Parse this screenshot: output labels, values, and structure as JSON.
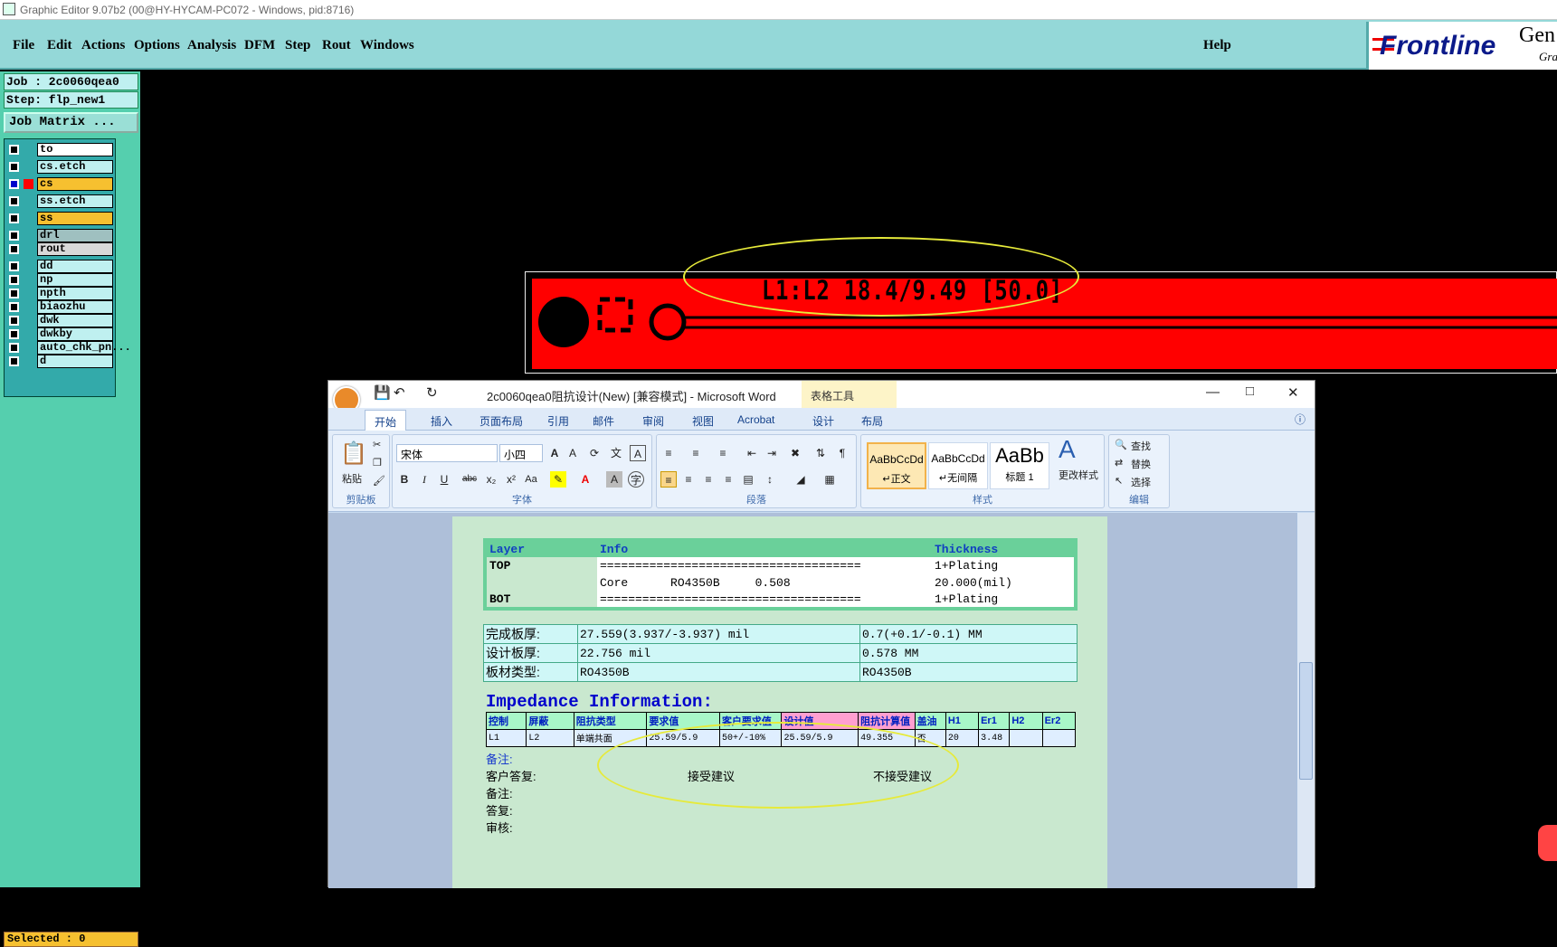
{
  "window": {
    "title": "Graphic Editor 9.07b2 (00@HY-HYCAM-PC072 - Windows, pid:8716)"
  },
  "menu": {
    "items": [
      "File",
      "Edit",
      "Actions",
      "Options",
      "Analysis",
      "DFM",
      "Step",
      "Rout",
      "Windows"
    ],
    "help": "Help"
  },
  "logo": {
    "brand": "Frontline",
    "product": "Gen",
    "sub": "Gra"
  },
  "left": {
    "job": "Job : 2c0060qea0",
    "step": "Step: flp_new1",
    "matrix_button": "Job Matrix ...",
    "selected": "Selected : 0"
  },
  "layers": [
    {
      "name": "to",
      "color": "#ffffff"
    },
    {
      "name": "cs.etch",
      "color": "#bff0f0"
    },
    {
      "name": "cs",
      "color": "#f6c030"
    },
    {
      "name": "ss.etch",
      "color": "#bff0f0"
    },
    {
      "name": "ss",
      "color": "#f6c030"
    },
    {
      "name": "drl",
      "color": "#9fc0c0"
    },
    {
      "name": "rout",
      "color": "#d8d8d8"
    },
    {
      "name": "dd",
      "color": "#bff0f0"
    },
    {
      "name": "np",
      "color": "#bff0f0"
    },
    {
      "name": "npth",
      "color": "#bff0f0"
    },
    {
      "name": "biaozhu",
      "color": "#bff0f0"
    },
    {
      "name": "dwk",
      "color": "#bff0f0"
    },
    {
      "name": "dwkby",
      "color": "#bff0f0"
    },
    {
      "name": "auto_chk_pn...",
      "color": "#bff0f0"
    },
    {
      "name": "d",
      "color": "#bff0f0"
    }
  ],
  "canvas": {
    "label": "L1:L2  18.4/9.49  [50.0]"
  },
  "word": {
    "title": "2c0060qea0阻抗设计(New) [兼容模式] - Microsoft Word",
    "table_tools": "表格工具",
    "tabs": [
      "开始",
      "插入",
      "页面布局",
      "引用",
      "邮件",
      "审阅",
      "视图",
      "Acrobat",
      "设计",
      "布局"
    ],
    "ribbon": {
      "clipboard": {
        "label": "剪贴板",
        "paste": "粘贴"
      },
      "font": {
        "label": "字体",
        "name": "宋体",
        "size": "小四"
      },
      "paragraph": {
        "label": "段落"
      },
      "styles": {
        "label": "样式",
        "items": [
          {
            "preview": "AaBbCcDd",
            "name": "↵正文"
          },
          {
            "preview": "AaBbCcDd",
            "name": "↵无间隔"
          },
          {
            "preview": "AaBb",
            "name": "标题 1"
          }
        ],
        "change": "更改样式"
      },
      "editing": {
        "label": "编辑",
        "find": "查找",
        "replace": "替换",
        "select": "选择"
      }
    },
    "doc": {
      "stack_headers": [
        "Layer",
        "Info",
        "Thickness"
      ],
      "stack_rows": [
        [
          "TOP",
          "=====================================",
          "1+Plating"
        ],
        [
          "",
          "Core      RO4350B     0.508",
          "20.000(mil)"
        ],
        [
          "BOT",
          "=====================================",
          "1+Plating"
        ]
      ],
      "board_rows": [
        [
          "完成板厚:",
          "27.559(3.937/-3.937) mil",
          "0.7(+0.1/-0.1) MM"
        ],
        [
          "设计板厚:",
          "22.756 mil",
          "0.578 MM"
        ],
        [
          "板材类型:",
          "RO4350B",
          "RO4350B"
        ]
      ],
      "impedance_title": "Impedance Information:",
      "imp_headers": [
        "控制",
        "屏蔽",
        "阻抗类型",
        "要求值",
        "客户要求值",
        "设计值",
        "阻抗计算值",
        "盖油",
        "H1",
        "Er1",
        "H2",
        "Er2"
      ],
      "imp_row": [
        "L1",
        "L2",
        "单端共面",
        "25.59/5.9",
        "50+/-10%",
        "25.59/5.9",
        "49.355",
        "否",
        "20",
        "3.48",
        "",
        ""
      ],
      "notes_label": "备注:",
      "reply": {
        "label": "客户答复:",
        "accept": "接受建议",
        "reject": "不接受建议"
      },
      "lines": [
        "备注:",
        "答复:",
        "审核:"
      ]
    }
  }
}
